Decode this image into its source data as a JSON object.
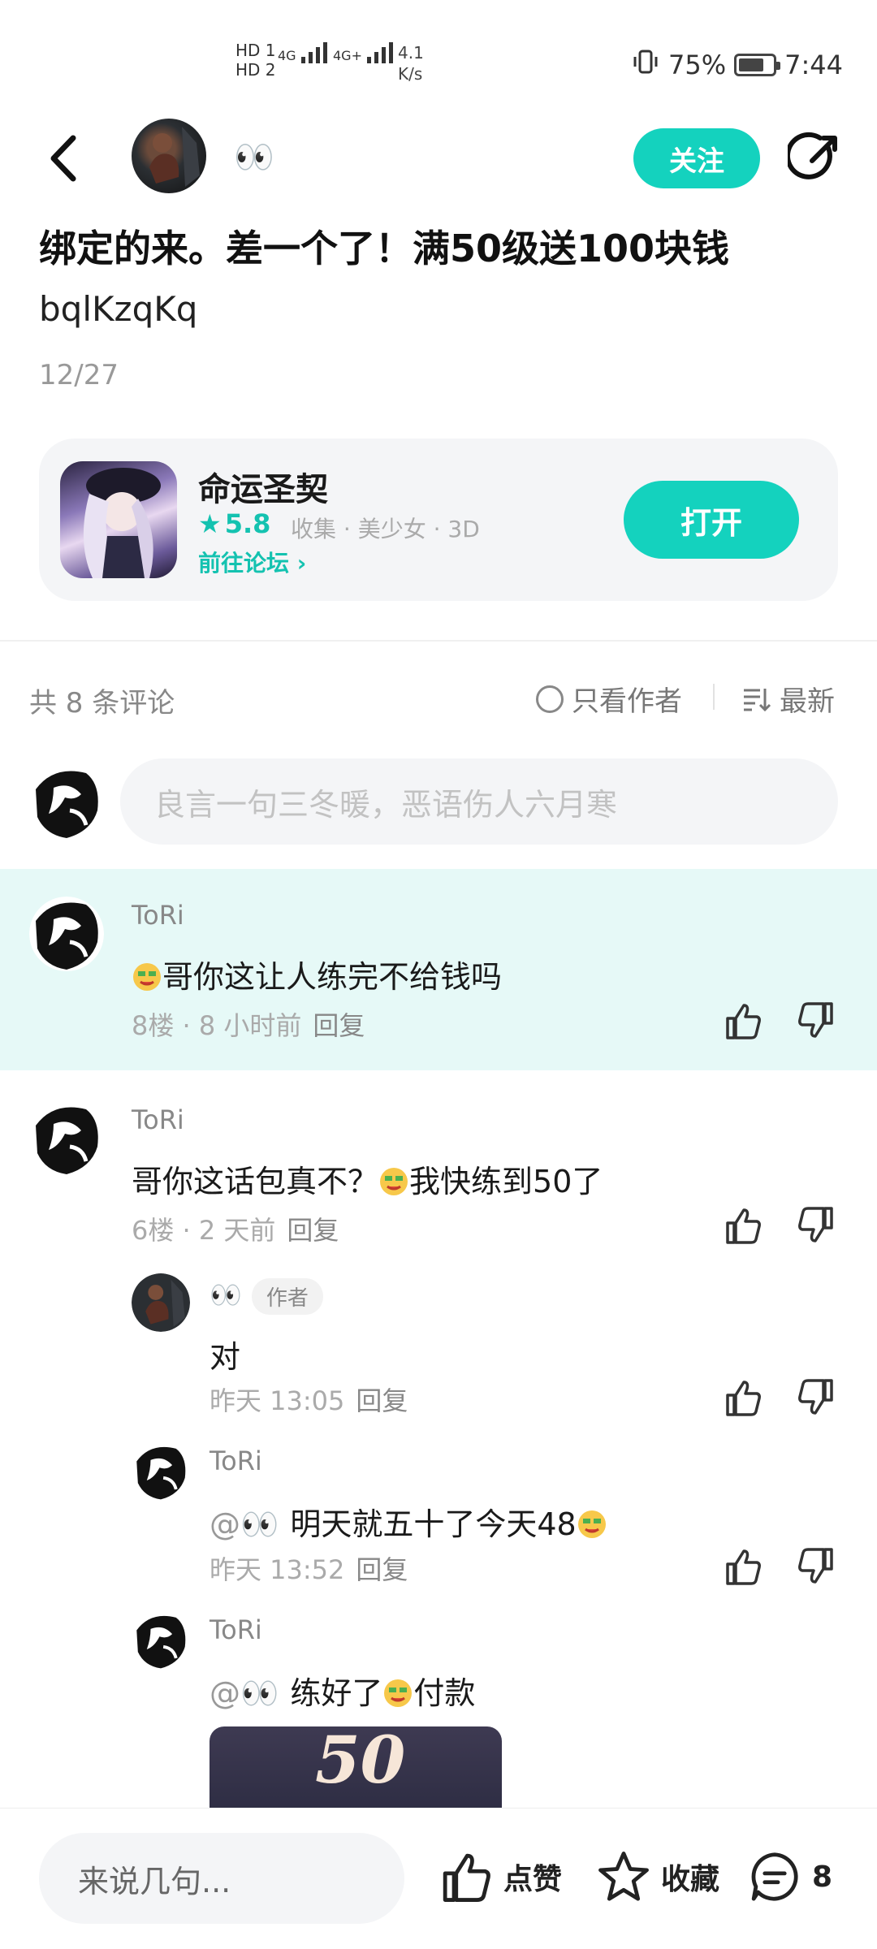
{
  "status_bar": {
    "network": [
      "HD 1",
      "HD 2"
    ],
    "signal1": "4G",
    "signal2": "4G+",
    "speed": "4.1",
    "speed_unit": "K/s",
    "battery": "75%",
    "battery_level": 0.75,
    "time": "7:44"
  },
  "header": {
    "author_name": "👀",
    "follow_label": "关注"
  },
  "post": {
    "title": "绑定的来。差一个了！满50级送100块钱",
    "subtitle": "bqlKzqKq",
    "date": "12/27"
  },
  "game_card": {
    "name": "命运圣契",
    "rating": "5.8",
    "tags": "收集 · 美少女 · 3D",
    "forum_link": "前往论坛 ›",
    "open_label": "打开"
  },
  "comments_bar": {
    "count_label": "共 8 条评论",
    "only_author": "只看作者",
    "sort": "最新"
  },
  "comment_input": {
    "placeholder": "良言一句三冬暖，恶语伤人六月寒"
  },
  "comments": [
    {
      "name": "ToRi",
      "text": "哥你这让人练完不给钱吗",
      "floor_time": "8楼 · 8 小时前",
      "reply": "回复"
    },
    {
      "name": "ToRi",
      "text_a": "哥你这话包真不？",
      "text_b": "我快练到50了",
      "floor_time": "6楼 · 2 天前",
      "reply": "回复",
      "replies": [
        {
          "name": "👀",
          "badge": "作者",
          "text": "对",
          "time": "昨天 13:05",
          "reply": "回复"
        },
        {
          "name": "ToRi",
          "mention": "@👀",
          "text": "明天就五十了今天48",
          "time": "昨天 13:52",
          "reply": "回复"
        },
        {
          "name": "ToRi",
          "mention": "@👀",
          "text_a": "练好了",
          "text_b": "付款",
          "image_text": "50"
        }
      ]
    }
  ],
  "bottom_bar": {
    "say_placeholder": "来说几句...",
    "like": "点赞",
    "collect": "收藏",
    "comments_count": "8"
  }
}
